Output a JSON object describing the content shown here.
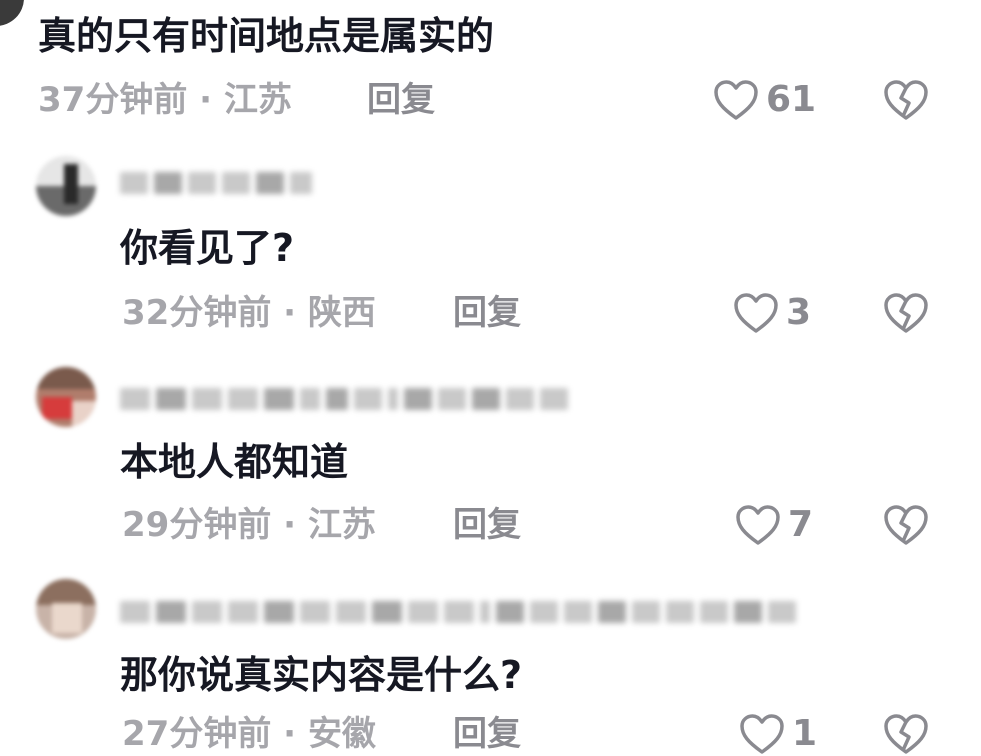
{
  "comments": [
    {
      "text": "真的只有时间地点是属实的",
      "time": "37分钟前",
      "location": "江苏",
      "reply_label": "回复",
      "likes": "61"
    },
    {
      "text": "你看见了?",
      "time": "32分钟前",
      "location": "陕西",
      "reply_label": "回复",
      "likes": "3"
    },
    {
      "text": "本地人都知道",
      "time": "29分钟前",
      "location": "江苏",
      "reply_label": "回复",
      "likes": "7"
    },
    {
      "text": "那你说真实内容是什么?",
      "time": "27分钟前",
      "location": "安徽",
      "reply_label": "回复",
      "likes": "1"
    }
  ],
  "separator": "·",
  "icons": {
    "like": "heart-outline-icon",
    "dislike": "broken-heart-icon"
  },
  "colors": {
    "text": "#161823",
    "meta": "#a6a6ab",
    "action": "#8a8a90"
  }
}
